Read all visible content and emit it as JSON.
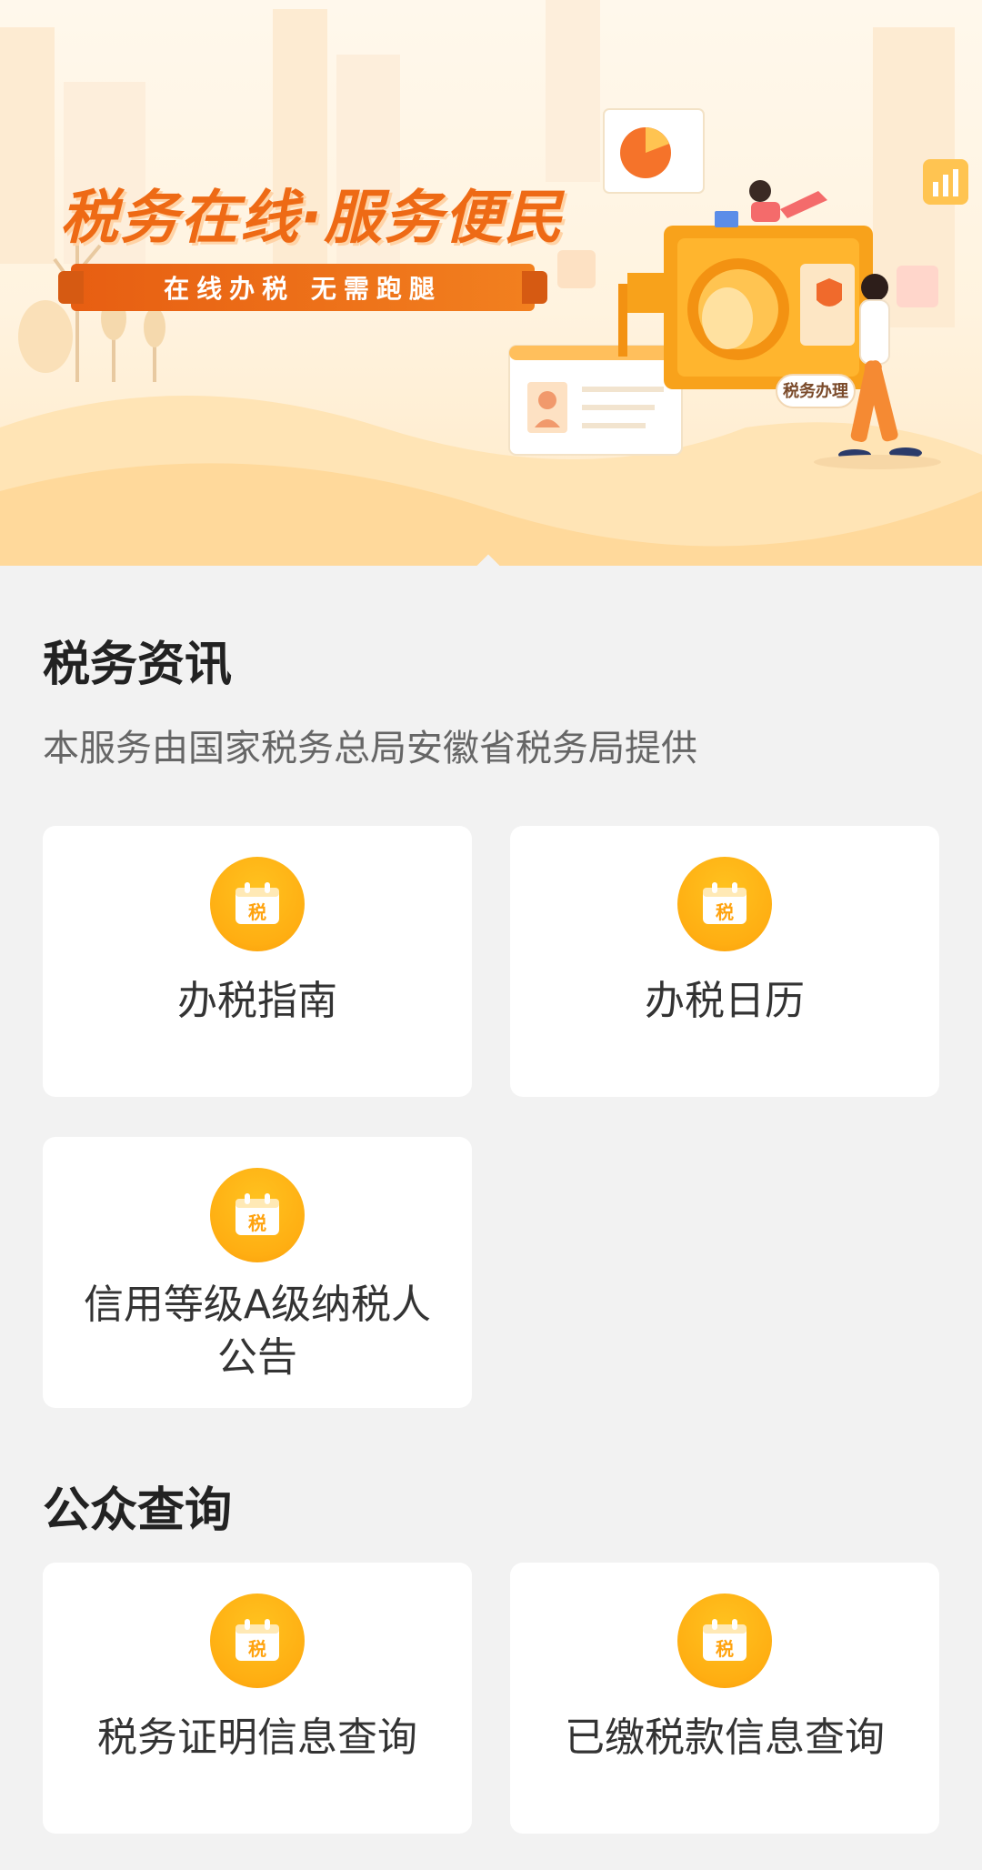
{
  "banner": {
    "title": "税务在线·服务便民",
    "ribbon": "在线办税 无需跑腿",
    "tag": "税务办理",
    "icon_char": "税"
  },
  "sections": [
    {
      "title": "税务资讯",
      "subtitle": "本服务由国家税务总局安徽省税务局提供",
      "cards": [
        {
          "label": "办税指南",
          "icon": "tax-calendar-icon"
        },
        {
          "label": "办税日历",
          "icon": "tax-calendar-icon"
        },
        {
          "label": "信用等级A级纳税人公告",
          "icon": "tax-calendar-icon"
        }
      ]
    },
    {
      "title": "公众查询",
      "cards": [
        {
          "label": "税务证明信息查询",
          "icon": "tax-calendar-icon"
        },
        {
          "label": "已缴税款信息查询",
          "icon": "tax-calendar-icon"
        }
      ]
    }
  ],
  "colors": {
    "accent": "#ee6a15",
    "icon_yellow": "#ffb515",
    "background": "#f2f2f2",
    "card": "#ffffff"
  }
}
